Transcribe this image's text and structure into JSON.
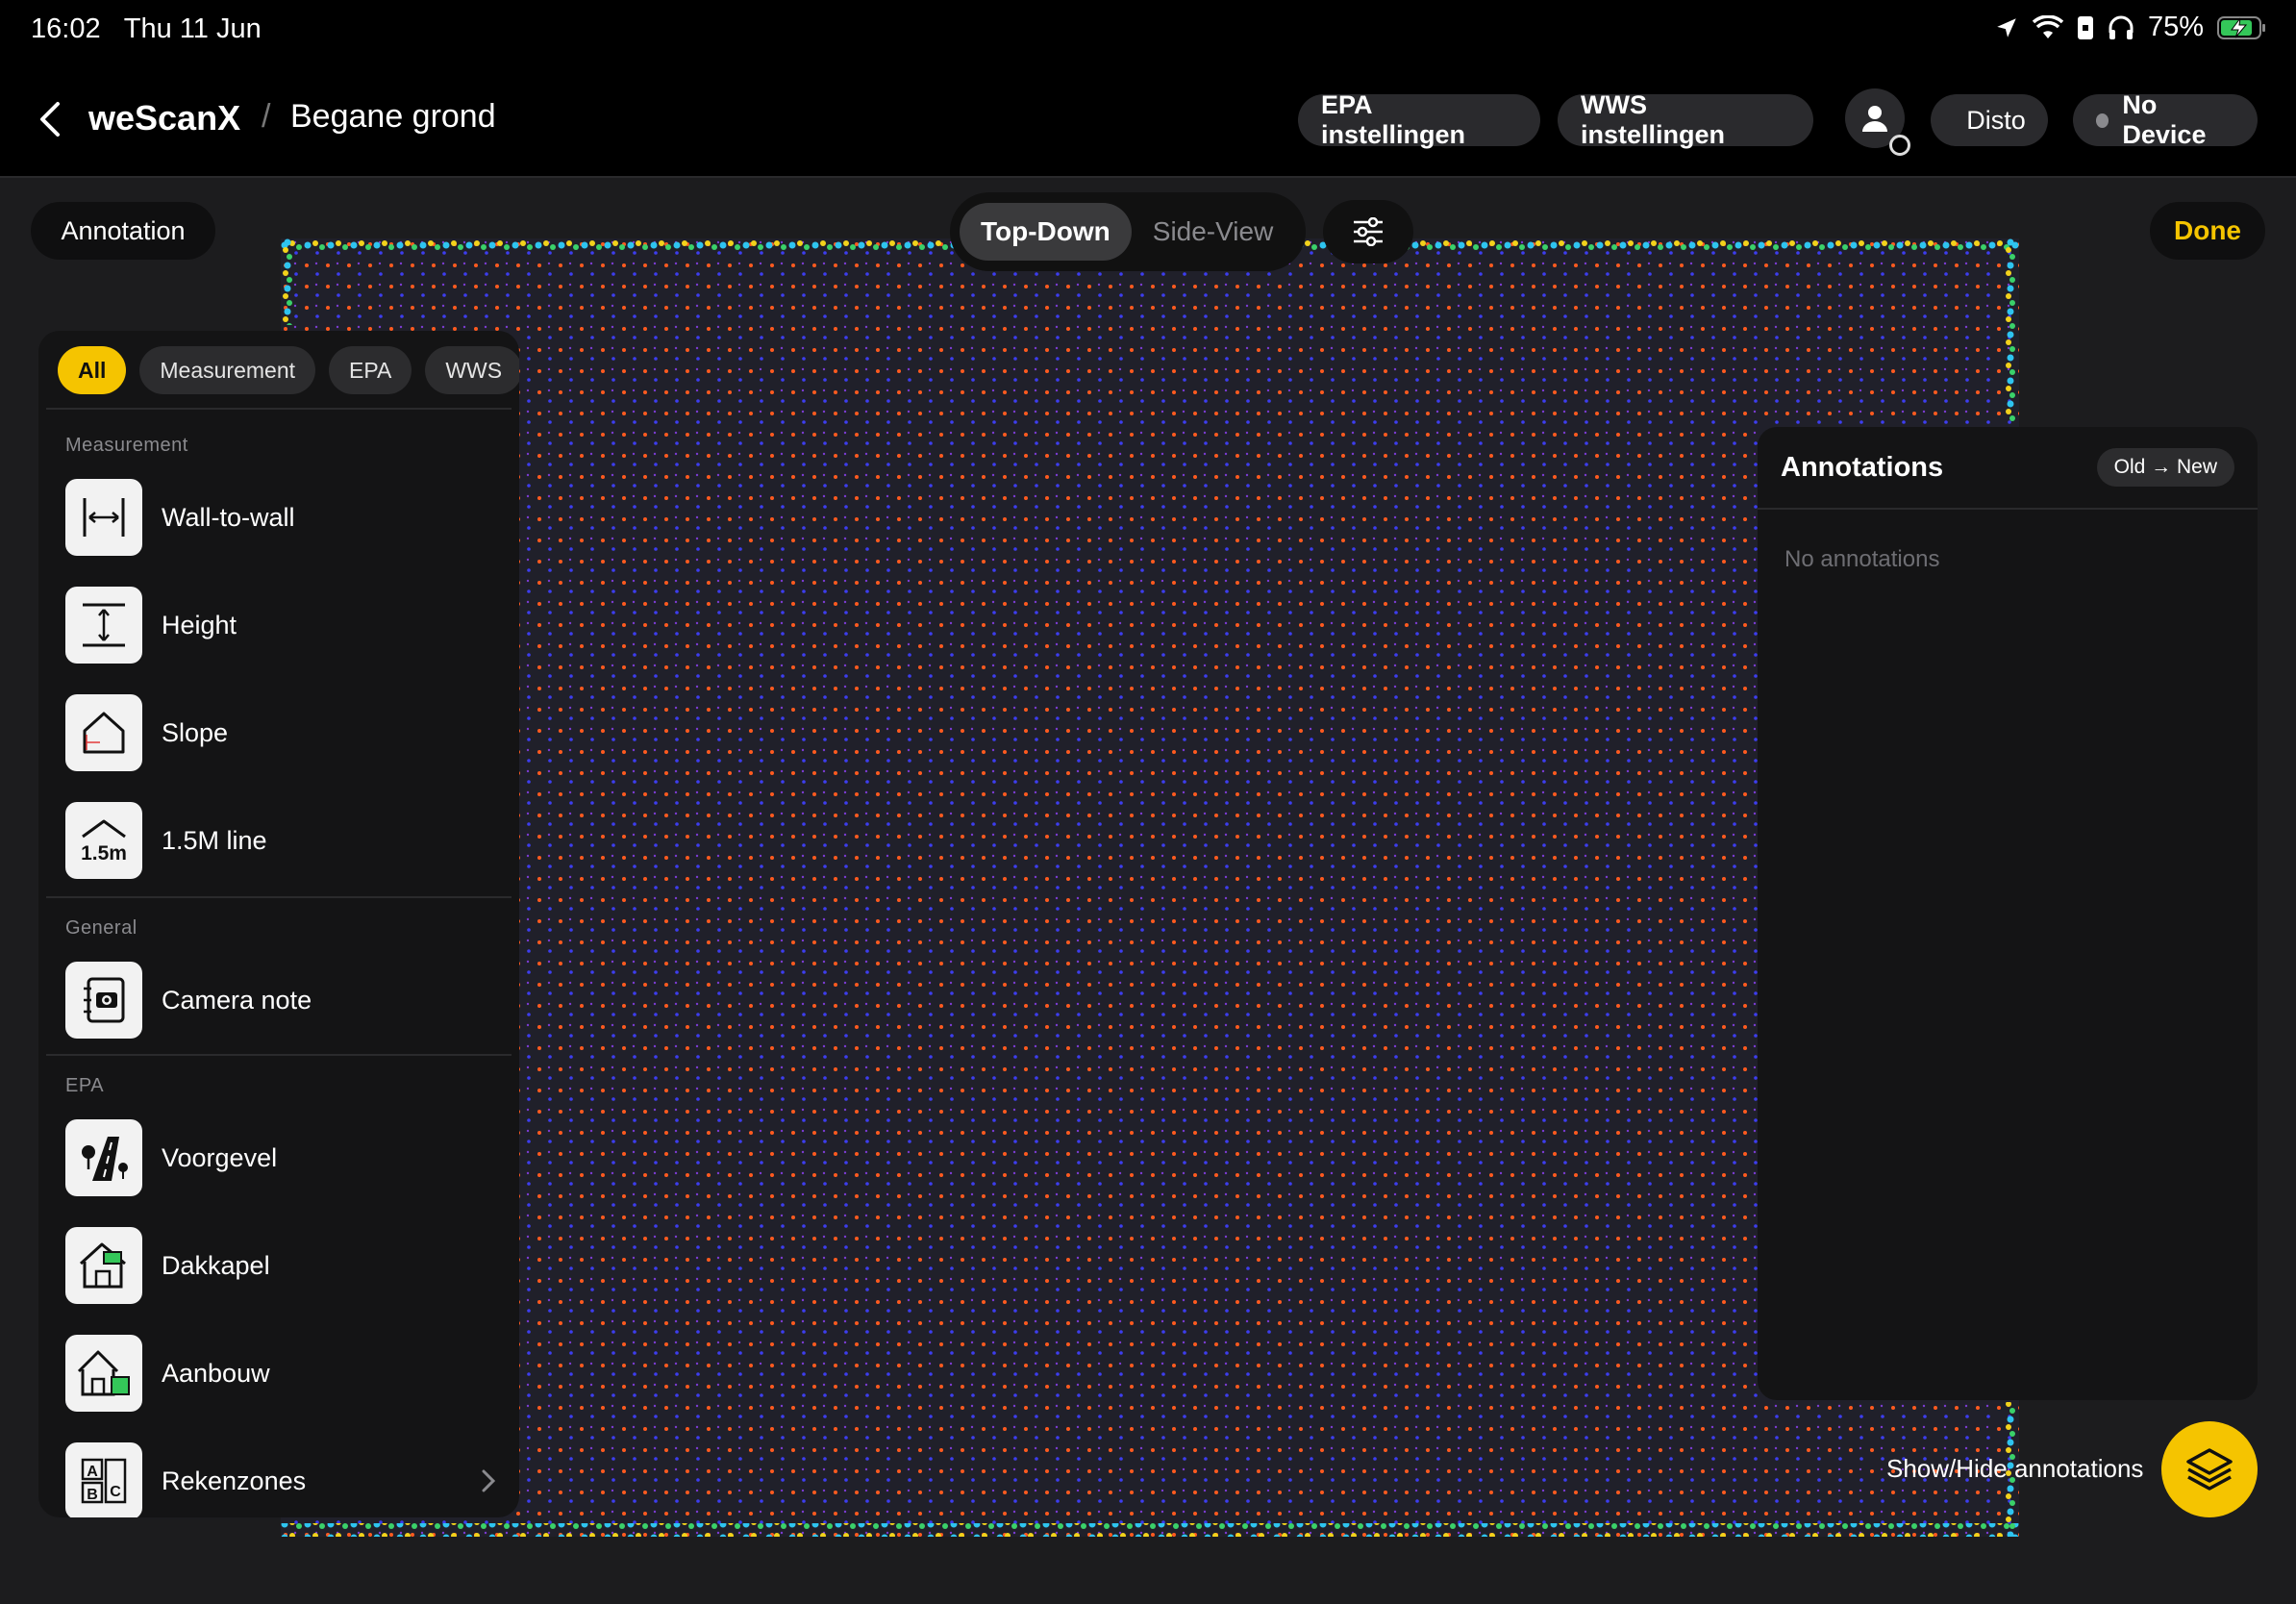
{
  "status_bar": {
    "time": "16:02",
    "date": "Thu 11 Jun",
    "battery": "75%",
    "icons": [
      "location-icon",
      "wifi-icon",
      "lock-rotation-icon",
      "headphones-icon",
      "battery-charging-icon"
    ]
  },
  "nav": {
    "app_title": "weScanX",
    "separator": "/",
    "page_title": "Begane grond",
    "epa_button": "EPA instellingen",
    "wws_button": "WWS instellingen",
    "disto_label": "Disto",
    "device_label": "No Device"
  },
  "toolbar": {
    "mode_label": "Annotation",
    "views": [
      "Top-Down",
      "Side-View"
    ],
    "active_view": "Top-Down",
    "done_label": "Done"
  },
  "tool_panel": {
    "filters": [
      "All",
      "Measurement",
      "EPA",
      "WWS"
    ],
    "active_filter": "All",
    "sections": [
      {
        "label": "Measurement",
        "items": [
          {
            "label": "Wall-to-wall",
            "icon": "wall-to-wall-icon"
          },
          {
            "label": "Height",
            "icon": "height-icon"
          },
          {
            "label": "Slope",
            "icon": "slope-icon"
          },
          {
            "label": "1.5M line",
            "icon": "line-1-5m-icon",
            "icon_text": "1.5m"
          }
        ]
      },
      {
        "label": "General",
        "items": [
          {
            "label": "Camera note",
            "icon": "camera-note-icon"
          }
        ]
      },
      {
        "label": "EPA",
        "items": [
          {
            "label": "Voorgevel",
            "icon": "voorgevel-icon"
          },
          {
            "label": "Dakkapel",
            "icon": "dakkapel-icon"
          },
          {
            "label": "Aanbouw",
            "icon": "aanbouw-icon"
          },
          {
            "label": "Rekenzones",
            "icon": "rekenzones-icon",
            "icon_text": [
              "A",
              "B",
              "C"
            ]
          }
        ]
      }
    ]
  },
  "annotations_panel": {
    "title": "Annotations",
    "sort_label": "Old → New",
    "empty_text": "No annotations"
  },
  "layers": {
    "toggle_label": "Show/Hide annotations"
  },
  "colors": {
    "accent": "#f5c400",
    "background": "#1c1c1e",
    "panel": "#141415",
    "scan_dot_primary": "#ff5a1f",
    "scan_dot_secondary": "#3d3df0"
  }
}
